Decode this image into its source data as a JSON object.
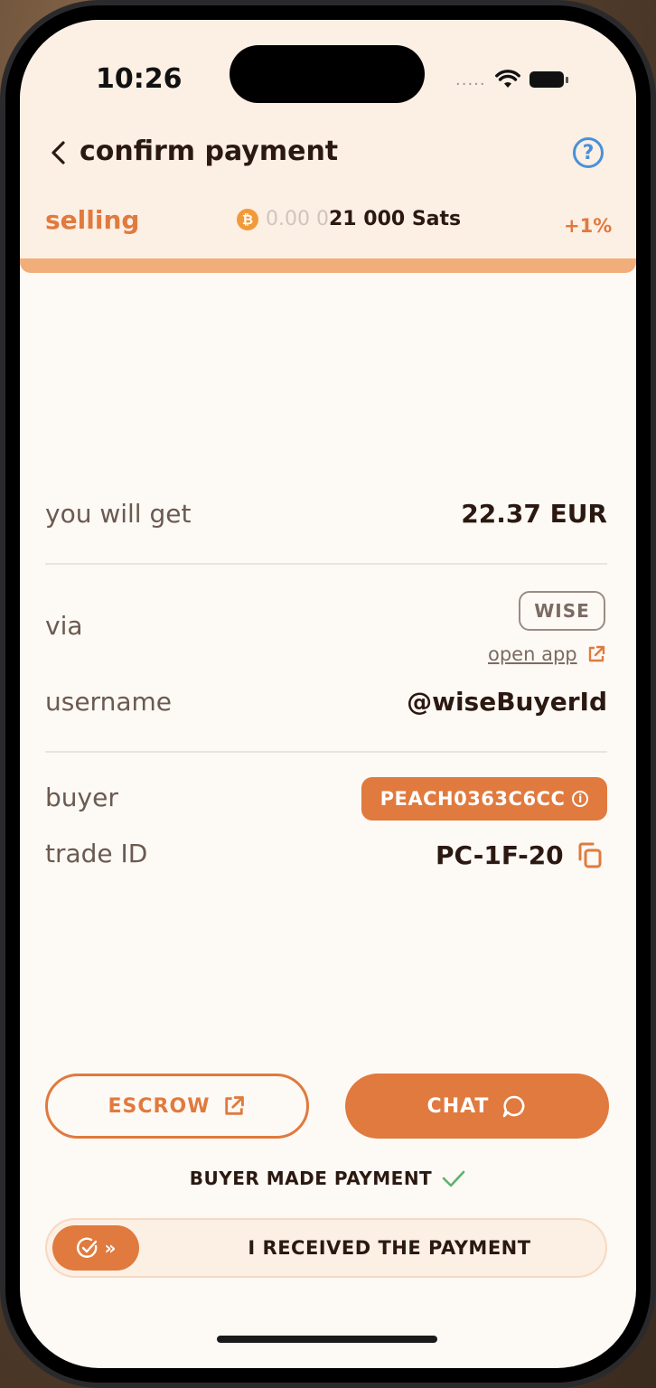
{
  "status_bar": {
    "time": "10:26",
    "signal": "....."
  },
  "header": {
    "title": "confirm payment",
    "help_symbol": "?",
    "mode": "selling",
    "btc_symbol": "₿",
    "amount_faded": "0.00 0",
    "amount_strong": "21 000 Sats",
    "premium": "+1%"
  },
  "details": {
    "get_label": "you will get",
    "get_value": "22.37 EUR",
    "via_label": "via",
    "via_value": "WISE",
    "open_app": "open app",
    "username_label": "username",
    "username_value": "@wiseBuyerId",
    "buyer_label": "buyer",
    "buyer_value": "PEACH0363C6CC",
    "trade_label": "trade ID",
    "trade_value": "PC-1F-20"
  },
  "actions": {
    "escrow": "ESCROW",
    "chat": "CHAT",
    "status": "BUYER MADE PAYMENT",
    "slide_label": "I RECEIVED THE PAYMENT",
    "slide_arrows": "»"
  },
  "colors": {
    "accent": "#e07a3e",
    "header_bg": "#fcefe4",
    "help": "#4a90d9",
    "check": "#5bb36a"
  }
}
